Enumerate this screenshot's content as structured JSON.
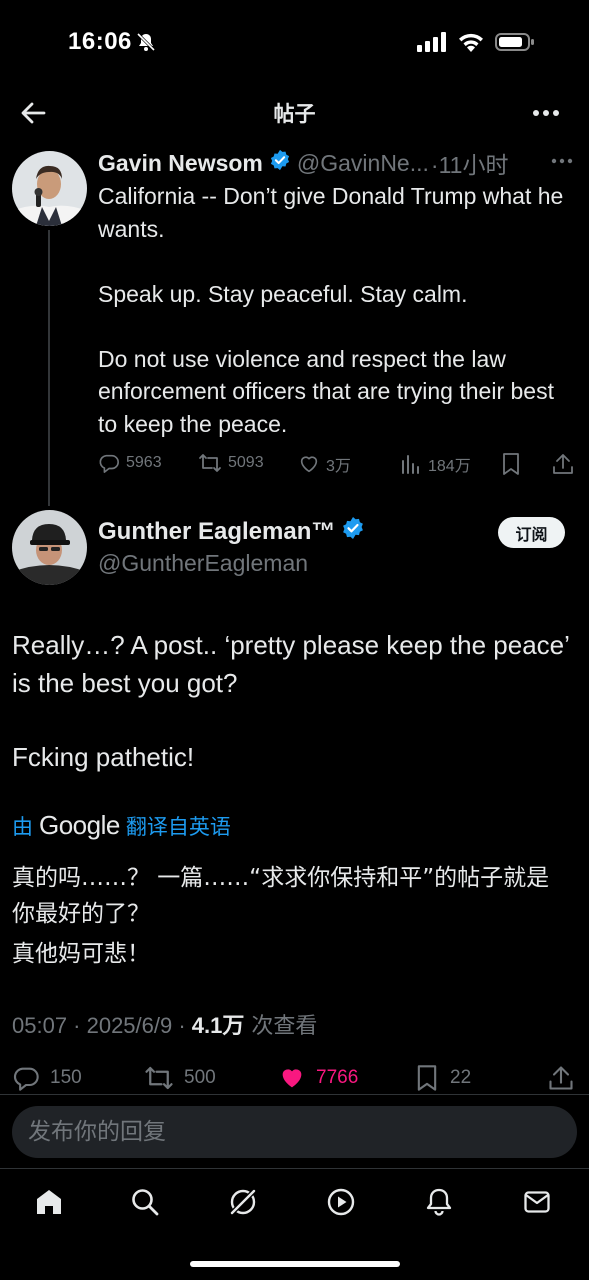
{
  "status_bar": {
    "time": "16:06"
  },
  "nav": {
    "title": "帖子"
  },
  "parent_tweet": {
    "author_name": "Gavin Newsom",
    "handle": "@GavinNe...",
    "time": "·11小时",
    "paragraphs": [
      "California -- Don’t give Donald Trump what he wants.",
      "Speak up. Stay peaceful. Stay calm.",
      "Do not use violence and respect the law enforcement officers that are trying their best to keep the peace."
    ],
    "actions": {
      "replies": "5963",
      "reposts": "5093",
      "likes": "3万",
      "views": "184万"
    }
  },
  "main_tweet": {
    "author_name": "Gunther Eagleman™",
    "handle": "@GuntherEagleman",
    "subscribe_label": "订阅",
    "paragraphs": [
      "Really…?   A post.. ‘pretty please keep the peace’ is the best you got?",
      "Fcking pathetic!"
    ],
    "translation": {
      "prefix": "由",
      "provider": "Google",
      "suffix": "翻译自英语",
      "paragraphs": [
        "真的吗……？ 一篇……“求求你保持和平”的帖子就是你最好的了？",
        "真他妈可悲！"
      ]
    },
    "meta": {
      "time": "05:07 · 2025/6/9 · ",
      "views_count": "4.1万",
      "views_label": " 次查看"
    },
    "actions": {
      "replies": "150",
      "reposts": "500",
      "likes": "7766",
      "bookmarks": "22"
    }
  },
  "reply": {
    "placeholder": "发布你的回复"
  },
  "colors": {
    "accent": "#1d9bf0",
    "like": "#f91880",
    "muted": "#71767b",
    "background": "#000000"
  }
}
